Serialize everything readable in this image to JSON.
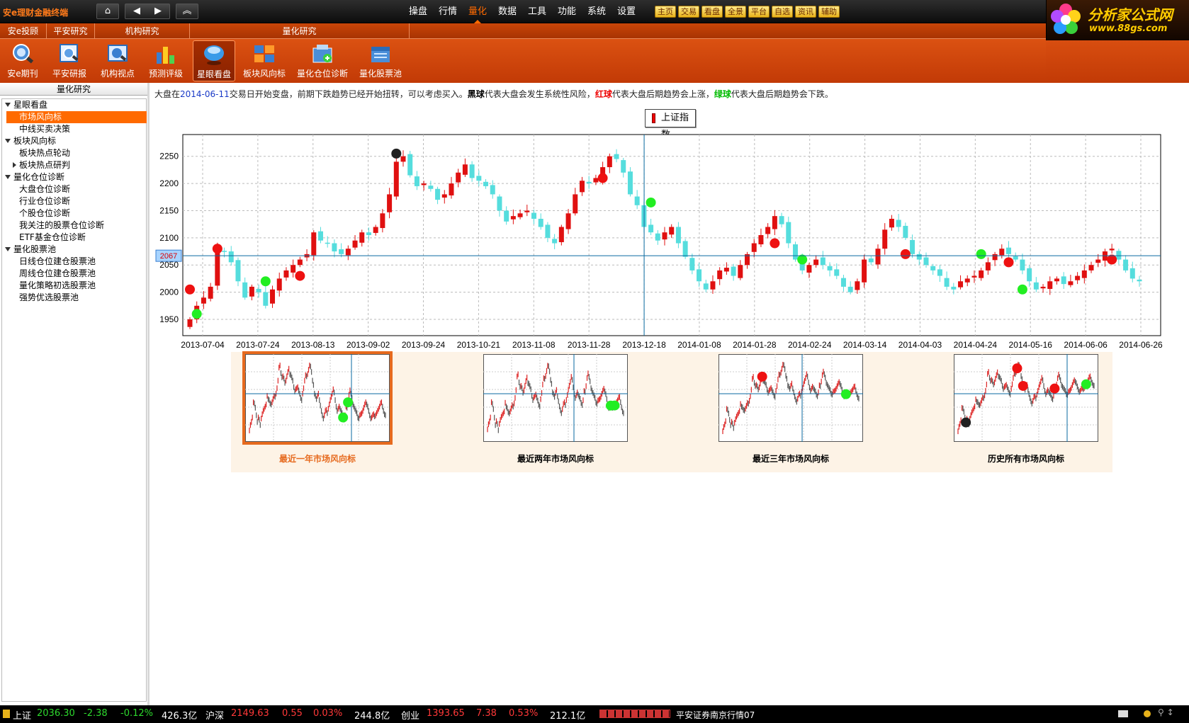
{
  "app": {
    "title": "安e理财金融终端"
  },
  "nav": {
    "home_icon": "home-icon",
    "back_icon": "arrow-left-icon",
    "forward_icon": "arrow-right-icon",
    "up_icon": "double-chevron-up-icon"
  },
  "menu": [
    {
      "label": "操盘"
    },
    {
      "label": "行情"
    },
    {
      "label": "量化"
    },
    {
      "label": "数据"
    },
    {
      "label": "工具"
    },
    {
      "label": "功能"
    },
    {
      "label": "系统"
    },
    {
      "label": "设置"
    }
  ],
  "menu_active": "量化",
  "quick": [
    {
      "label": "主页"
    },
    {
      "label": "交易"
    },
    {
      "label": "看盘"
    },
    {
      "label": "全景"
    },
    {
      "label": "平台"
    },
    {
      "label": "自选"
    },
    {
      "label": "资讯"
    },
    {
      "label": "辅助"
    }
  ],
  "logo": {
    "text": "分析家公式网",
    "url": "www.88gs.com"
  },
  "groups": [
    {
      "label": "安e投顾"
    },
    {
      "label": "平安研究"
    },
    {
      "label": "机构研究"
    },
    {
      "label": "量化研究"
    }
  ],
  "tools": [
    {
      "label": "安e期刊",
      "icon": "magnifier-icon"
    },
    {
      "label": "平安研报",
      "icon": "report-magnifier-icon"
    },
    {
      "label": "机构视点",
      "icon": "institution-view-icon"
    },
    {
      "label": "预测评级",
      "icon": "rating-bars-icon"
    },
    {
      "label": "星眼看盘",
      "icon": "eye-ball-icon"
    },
    {
      "label": "板块风向标",
      "icon": "sector-blocks-icon"
    },
    {
      "label": "量化仓位诊断",
      "icon": "position-diagnosis-icon"
    },
    {
      "label": "量化股票池",
      "icon": "stock-pool-icon"
    }
  ],
  "sidebar": {
    "header": "量化研究",
    "tree": [
      {
        "label": "星眼看盘",
        "level": 0
      },
      {
        "label": "市场风向标",
        "level": 1,
        "selected": true
      },
      {
        "label": "中线买卖决策",
        "level": 1
      },
      {
        "label": "板块风向标",
        "level": 0
      },
      {
        "label": "板块热点轮动",
        "level": 1
      },
      {
        "label": "板块热点研判",
        "level": 1,
        "collapsed": true
      },
      {
        "label": "量化仓位诊断",
        "level": 0
      },
      {
        "label": "大盘仓位诊断",
        "level": 1
      },
      {
        "label": "行业仓位诊断",
        "level": 1
      },
      {
        "label": "个股仓位诊断",
        "level": 1
      },
      {
        "label": "我关注的股票仓位诊断",
        "level": 1
      },
      {
        "label": "ETF基金仓位诊断",
        "level": 1
      },
      {
        "label": "量化股票池",
        "level": 0
      },
      {
        "label": "日线仓位建仓股票池",
        "level": 1
      },
      {
        "label": "周线仓位建仓股票池",
        "level": 1
      },
      {
        "label": "量化策略初选股票池",
        "level": 1
      },
      {
        "label": "强势优选股票池",
        "level": 1
      }
    ]
  },
  "description": {
    "p1": "大盘在",
    "date": "2014-06-11",
    "p2": "交易日开始变盘，前期下跌趋势已经开始扭转，可以考虑买入。",
    "black": "黑球",
    "p3": "代表大盘会发生系统性风险，",
    "red": "红球",
    "p4": "代表大盘后期趋势会上涨，",
    "green": "绿球",
    "p5": "代表大盘后期趋势会下跌。"
  },
  "chart_data": {
    "type": "candlestick",
    "legend": "上证指数",
    "ylim": [
      1920,
      2290
    ],
    "yticks": [
      1950,
      2000,
      2050,
      2100,
      2150,
      2200,
      2250
    ],
    "xticks": [
      "2013-07-04",
      "2013-07-24",
      "2013-08-13",
      "2013-09-02",
      "2013-09-24",
      "2013-10-21",
      "2013-11-08",
      "2013-11-28",
      "2013-12-18",
      "2014-01-08",
      "2014-01-28",
      "2014-02-24",
      "2014-03-14",
      "2014-04-03",
      "2014-04-24",
      "2014-05-16",
      "2014-06-06",
      "2014-06-26"
    ],
    "crosshair": {
      "value": 2067,
      "date": "2013-12-18"
    },
    "grid": true,
    "colors": {
      "up": "#e01010",
      "down": "#55dddd",
      "black_ball": "#202020",
      "red_ball": "#ee1111",
      "green_ball": "#22ee22"
    },
    "closes": [
      1950,
      1975,
      1990,
      2010,
      2080,
      2075,
      2055,
      2020,
      1990,
      2010,
      2000,
      1975,
      2005,
      2025,
      2040,
      2050,
      2060,
      2070,
      2110,
      2095,
      2090,
      2075,
      2070,
      2080,
      2095,
      2110,
      2105,
      2120,
      2145,
      2180,
      2240,
      2250,
      2215,
      2195,
      2200,
      2190,
      2170,
      2180,
      2200,
      2220,
      2235,
      2210,
      2205,
      2195,
      2180,
      2150,
      2130,
      2140,
      2145,
      2150,
      2135,
      2120,
      2100,
      2090,
      2120,
      2145,
      2180,
      2205,
      2200,
      2210,
      2230,
      2250,
      2245,
      2220,
      2180,
      2160,
      2120,
      2110,
      2095,
      2110,
      2120,
      2090,
      2065,
      2040,
      2020,
      2005,
      2020,
      2040,
      2045,
      2030,
      2050,
      2070,
      2090,
      2105,
      2120,
      2140,
      2125,
      2090,
      2060,
      2040,
      2050,
      2060,
      2050,
      2040,
      2030,
      2010,
      2000,
      2020,
      2060,
      2055,
      2080,
      2115,
      2135,
      2120,
      2100,
      2070,
      2060,
      2050,
      2040,
      2030,
      2010,
      2005,
      2020,
      2025,
      2030,
      2040,
      2055,
      2070,
      2080,
      2070,
      2060,
      2040,
      2020,
      2005,
      2010,
      2020,
      2025,
      2015,
      2020,
      2030,
      2040,
      2050,
      2060,
      2075,
      2080,
      2060,
      2040,
      2025,
      2020
    ],
    "balls": [
      {
        "i": 0,
        "v": 2005,
        "color": "red"
      },
      {
        "i": 1,
        "v": 1960,
        "color": "green"
      },
      {
        "i": 4,
        "v": 2080,
        "color": "red"
      },
      {
        "i": 11,
        "v": 2020,
        "color": "green"
      },
      {
        "i": 16,
        "v": 2030,
        "color": "red"
      },
      {
        "i": 30,
        "v": 2255,
        "color": "black"
      },
      {
        "i": 60,
        "v": 2210,
        "color": "red"
      },
      {
        "i": 67,
        "v": 2165,
        "color": "green"
      },
      {
        "i": 85,
        "v": 2090,
        "color": "red"
      },
      {
        "i": 89,
        "v": 2060,
        "color": "green"
      },
      {
        "i": 104,
        "v": 2070,
        "color": "red"
      },
      {
        "i": 115,
        "v": 2070,
        "color": "green"
      },
      {
        "i": 119,
        "v": 2055,
        "color": "red"
      },
      {
        "i": 121,
        "v": 2005,
        "color": "green"
      },
      {
        "i": 134,
        "v": 2060,
        "color": "red"
      }
    ]
  },
  "thumbnails": [
    {
      "label": "最近一年市场风向标",
      "active": true
    },
    {
      "label": "最近两年市场风向标",
      "active": false
    },
    {
      "label": "最近三年市场风向标",
      "active": false
    },
    {
      "label": "历史所有市场风向标",
      "active": false
    }
  ],
  "status": {
    "sh_label": "上证",
    "sh_value": "2036.30",
    "sh_change": "-2.38",
    "sh_pct": "-0.12%",
    "sh_amount": "426.3亿",
    "hs_label": "沪深",
    "hs_value": "2149.63",
    "hs_change": "0.55",
    "hs_pct": "0.03%",
    "hs_amount": "244.8亿",
    "cy_label": "创业",
    "cy_value": "1393.65",
    "cy_change": "7.38",
    "cy_pct": "0.53%",
    "cy_amount": "212.1亿",
    "server": "平安证券南京行情07"
  }
}
